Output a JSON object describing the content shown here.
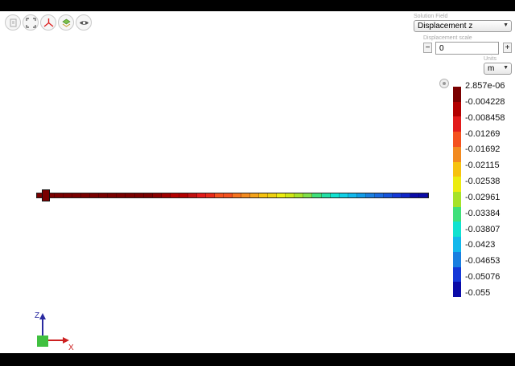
{
  "toolbar": {
    "buttons": [
      "open-icon",
      "fit-view-icon",
      "axes-view-icon",
      "layers-icon",
      "eye-icon"
    ]
  },
  "solution_field": {
    "label": "Solution Field",
    "value": "Displacement z"
  },
  "displacement_scale": {
    "label": "Displacement scale",
    "minus": "−",
    "value": "0",
    "plus": "+"
  },
  "units": {
    "label": "Units",
    "value": "m"
  },
  "legend": {
    "labels": [
      "2.857e-06",
      "-0.004228",
      "-0.008458",
      "-0.01269",
      "-0.01692",
      "-0.02115",
      "-0.02538",
      "-0.02961",
      "-0.03384",
      "-0.03807",
      "-0.0423",
      "-0.04653",
      "-0.05076",
      "-0.055"
    ],
    "colors": [
      "#7a0000",
      "#b30000",
      "#e21b1b",
      "#f4511e",
      "#f28a1f",
      "#f6c20f",
      "#ecec10",
      "#a6e22a",
      "#3fe07a",
      "#10e2d0",
      "#12b8ec",
      "#1a7fe0",
      "#1538d8",
      "#0b0ba8"
    ]
  },
  "beam": {
    "colors": [
      "#7a0000",
      "#7a0000",
      "#7a0000",
      "#7a0000",
      "#7a0000",
      "#7a0000",
      "#7a0000",
      "#7a0000",
      "#7a0000",
      "#7a0000",
      "#7a0000",
      "#7a0000",
      "#7a0000",
      "#8a0000",
      "#a00000",
      "#b30000",
      "#b30000",
      "#c01010",
      "#e21b1b",
      "#e82a1a",
      "#f4511e",
      "#f4511e",
      "#f6731e",
      "#f28a1f",
      "#f4a21a",
      "#f6c20f",
      "#eed010",
      "#ecec10",
      "#cfe615",
      "#a6e22a",
      "#7fe04a",
      "#3fe07a",
      "#22e0a6",
      "#10e2d0",
      "#10d0e6",
      "#12b8ec",
      "#129ce8",
      "#1a7fe0",
      "#1a6ae0",
      "#1553dc",
      "#1538d8",
      "#1026c8",
      "#0b0ba8",
      "#0b0ba8"
    ]
  },
  "axes": {
    "z": "Z",
    "x": "X",
    "z_color": "#2a2aa0",
    "x_color": "#cc2020",
    "origin_color": "#40c040"
  }
}
